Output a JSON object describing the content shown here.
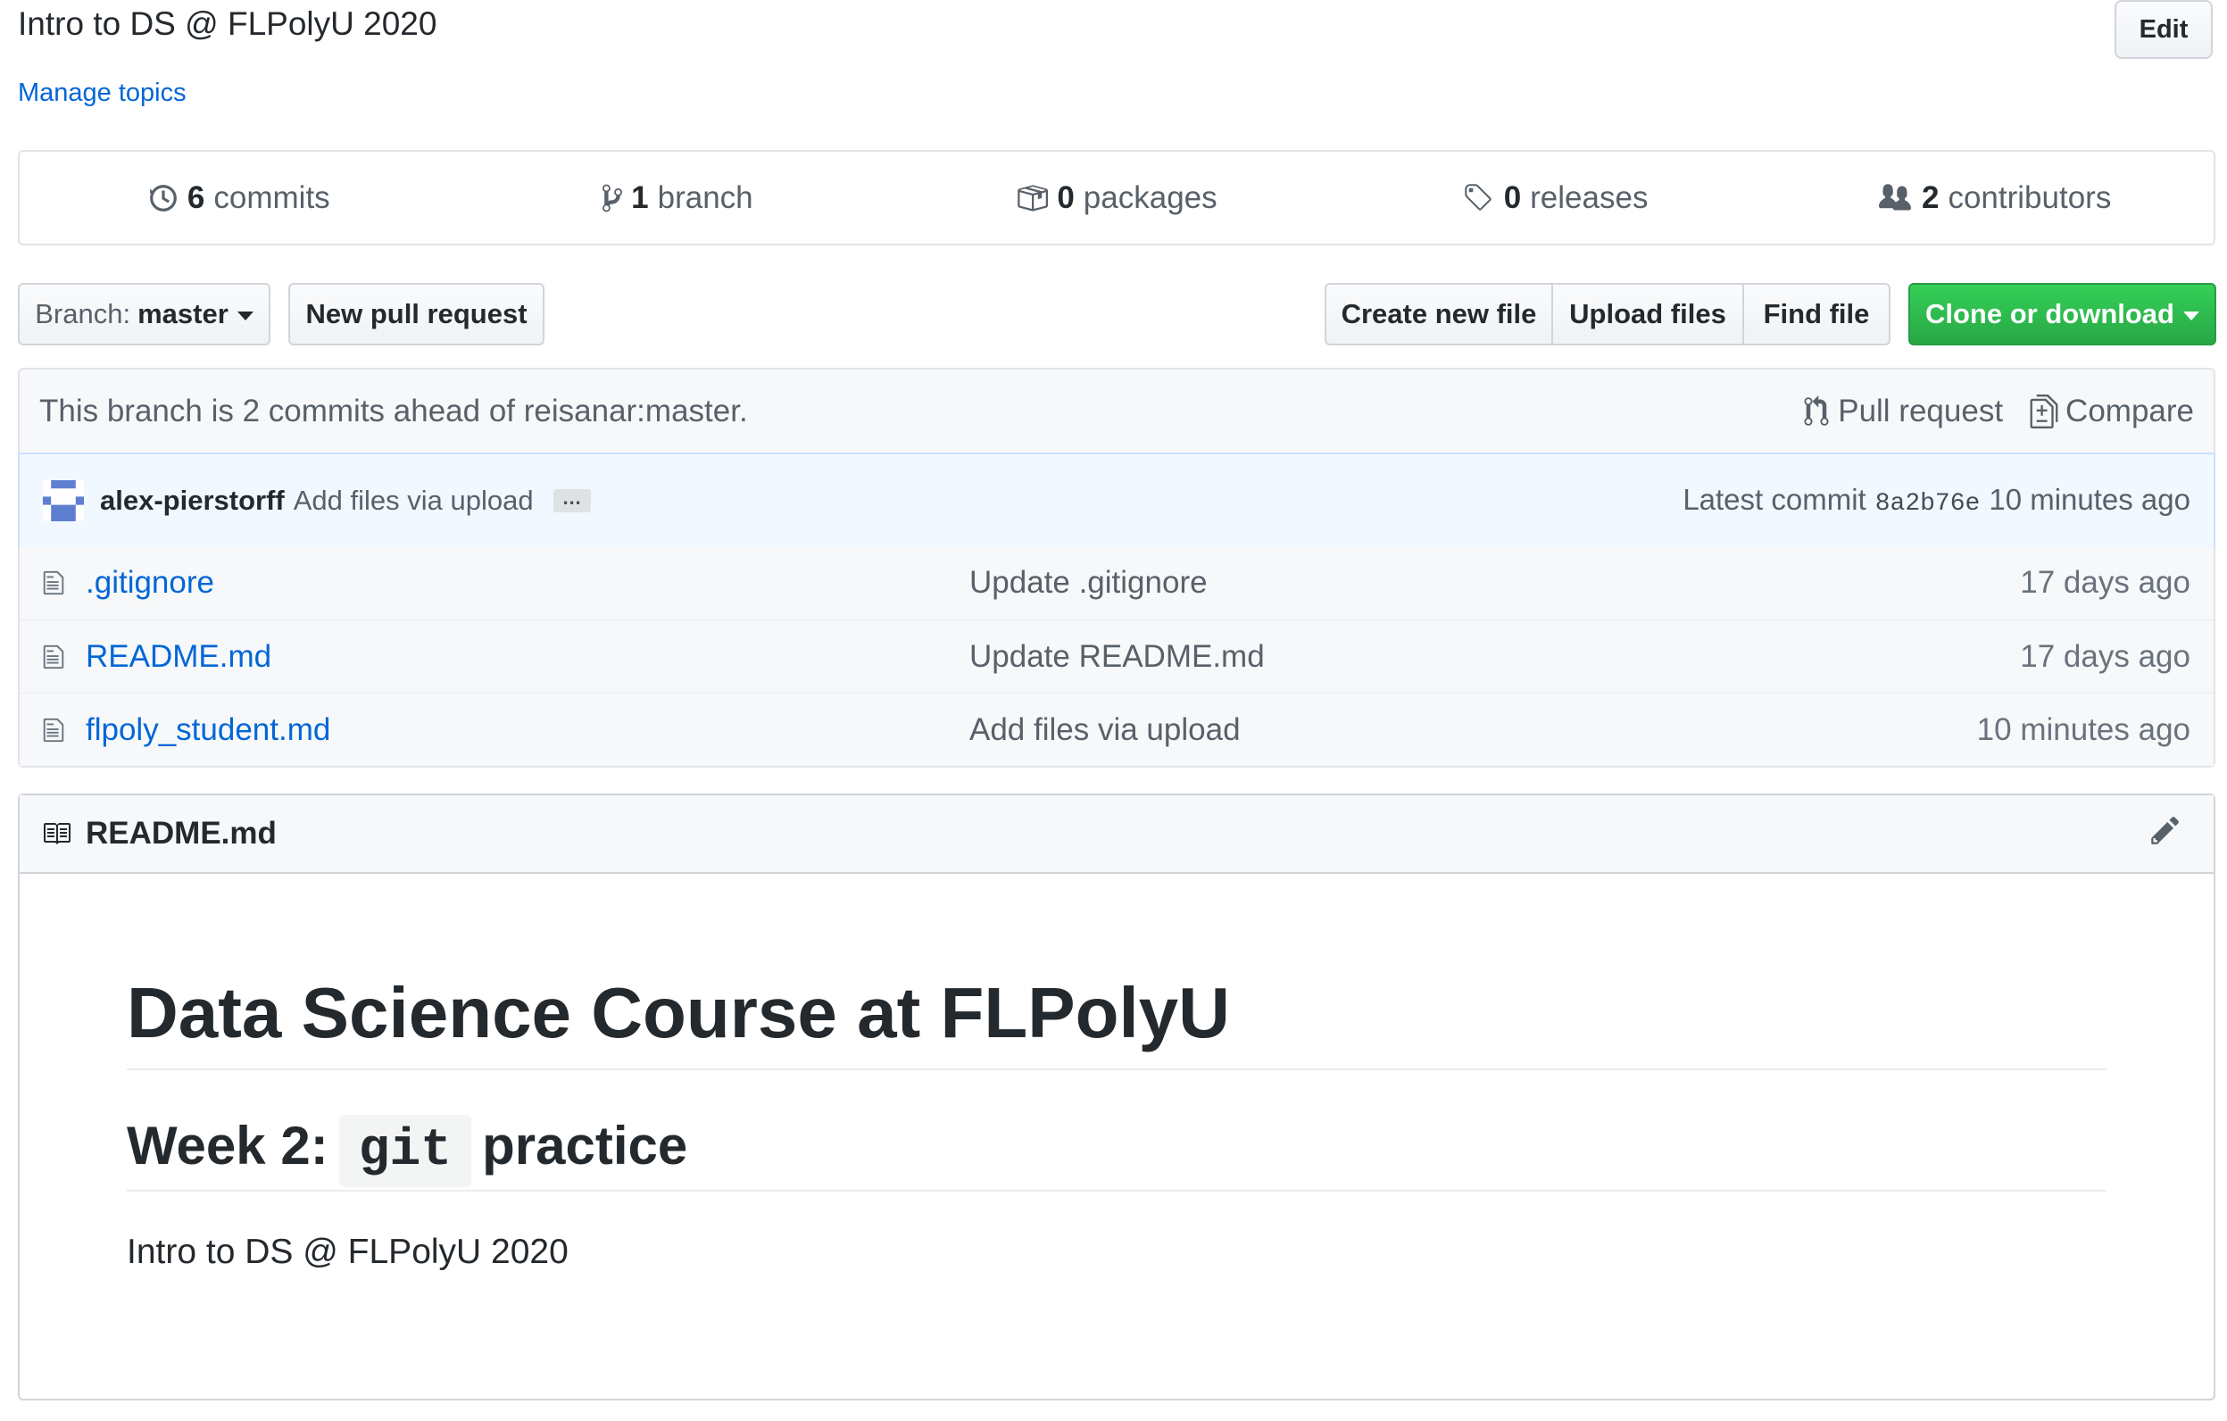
{
  "repo": {
    "description": "Intro to DS @ FLPolyU 2020",
    "edit_label": "Edit",
    "manage_topics": "Manage topics"
  },
  "summary": {
    "commits_num": "6",
    "commits_label": "commits",
    "branch_num": "1",
    "branch_label": "branch",
    "packages_num": "0",
    "packages_label": "packages",
    "releases_num": "0",
    "releases_label": "releases",
    "contributors_num": "2",
    "contributors_label": "contributors"
  },
  "toolbar": {
    "branch_prefix": "Branch:",
    "branch_name": "master",
    "new_pull_request": "New pull request",
    "create_new_file": "Create new file",
    "upload_files": "Upload files",
    "find_file": "Find file",
    "clone_or_download": "Clone or download"
  },
  "branch_info": {
    "text": "This branch is 2 commits ahead of reisanar:master.",
    "pull_request": "Pull request",
    "compare": "Compare"
  },
  "latest_commit": {
    "author": "alex-pierstorff",
    "message": "Add files via upload",
    "ellipsis": "…",
    "label": "Latest commit",
    "sha": "8a2b76e",
    "age": "10 minutes ago"
  },
  "files": [
    {
      "name": ".gitignore",
      "message": "Update .gitignore",
      "age": "17 days ago"
    },
    {
      "name": "README.md",
      "message": "Update README.md",
      "age": "17 days ago"
    },
    {
      "name": "flpoly_student.md",
      "message": "Add files via upload",
      "age": "10 minutes ago"
    }
  ],
  "readme": {
    "filename": "README.md",
    "h1": "Data Science Course at FLPolyU",
    "h2_prefix": "Week 2:",
    "h2_code": "git",
    "h2_suffix": "practice",
    "paragraph": "Intro to DS @ FLPolyU 2020"
  },
  "colors": {
    "link": "#0366d6",
    "clone_button": "#28a745",
    "commit_bar_bg": "#f1f8ff"
  }
}
